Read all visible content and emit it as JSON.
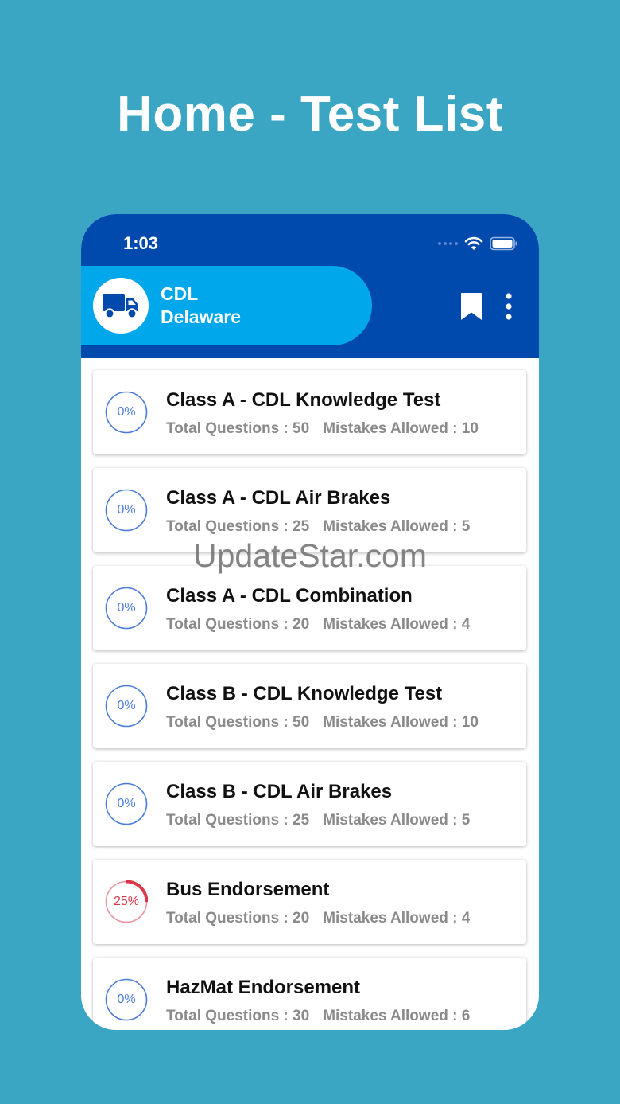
{
  "promo": {
    "title": "Home - Test List"
  },
  "status_bar": {
    "time": "1:03",
    "icons": [
      "signal-dots-icon",
      "wifi-icon",
      "battery-icon"
    ]
  },
  "header": {
    "title": "CDL",
    "subtitle": "Delaware",
    "logo_icon": "truck-icon",
    "actions": [
      "bookmark-icon",
      "more-vertical-icon"
    ]
  },
  "labels": {
    "total_questions": "Total Questions : ",
    "mistakes_allowed": "Mistakes Allowed : "
  },
  "tests": [
    {
      "title": "Class A - CDL Knowledge Test",
      "progress": "0%",
      "progress_value": 0,
      "total_questions": "50",
      "mistakes_allowed": "10"
    },
    {
      "title": "Class A - CDL Air Brakes",
      "progress": "0%",
      "progress_value": 0,
      "total_questions": "25",
      "mistakes_allowed": "5"
    },
    {
      "title": "Class A - CDL Combination",
      "progress": "0%",
      "progress_value": 0,
      "total_questions": "20",
      "mistakes_allowed": "4"
    },
    {
      "title": "Class B - CDL Knowledge Test",
      "progress": "0%",
      "progress_value": 0,
      "total_questions": "50",
      "mistakes_allowed": "10"
    },
    {
      "title": "Class B - CDL Air Brakes",
      "progress": "0%",
      "progress_value": 0,
      "total_questions": "25",
      "mistakes_allowed": "5"
    },
    {
      "title": "Bus Endorsement",
      "progress": "25%",
      "progress_value": 25,
      "total_questions": "20",
      "mistakes_allowed": "4"
    },
    {
      "title": "HazMat Endorsement",
      "progress": "0%",
      "progress_value": 0,
      "total_questions": "30",
      "mistakes_allowed": "6"
    }
  ],
  "colors": {
    "background": "#3ba6c4",
    "app_bar": "#004aad",
    "header_pill": "#00a7ea",
    "ring_idle": "#4a7bdc",
    "ring_progress": "#d9364a"
  },
  "watermark": "UpdateStar.com"
}
